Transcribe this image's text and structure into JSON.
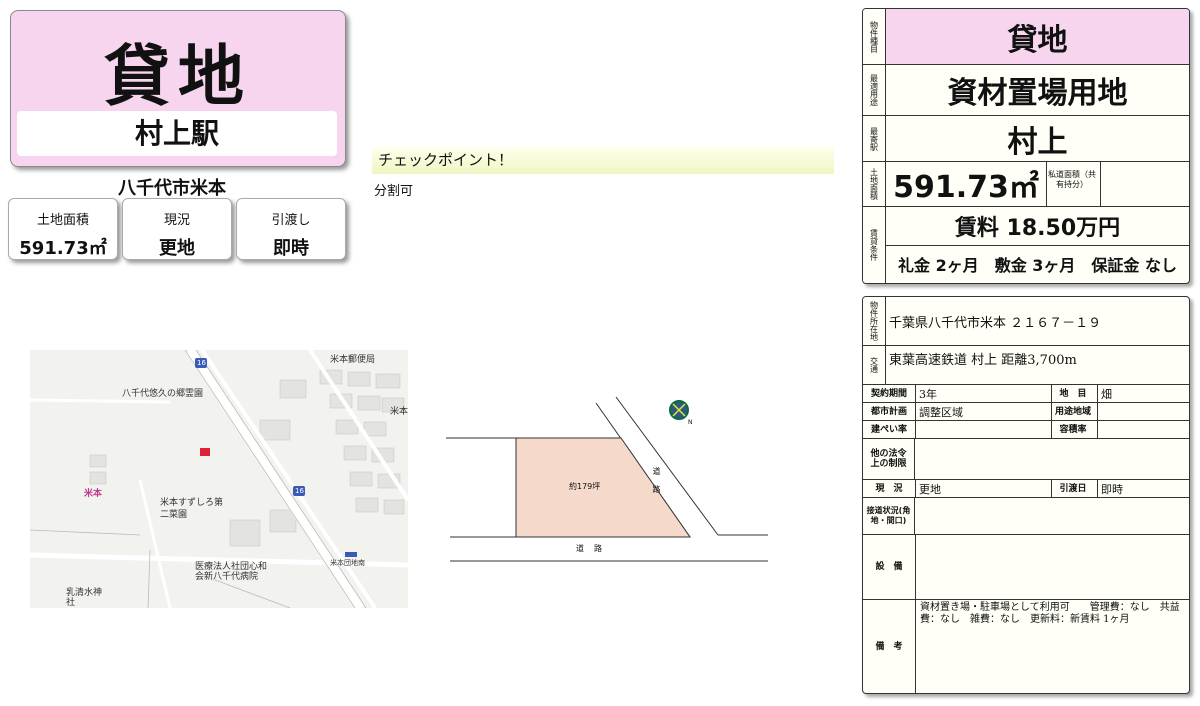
{
  "header": {
    "title": "貸地",
    "station": "村上駅",
    "address": "八千代市米本"
  },
  "cards": [
    {
      "label": "土地面積",
      "value": "591.73㎡"
    },
    {
      "label": "現況",
      "value": "更地"
    },
    {
      "label": "引渡し",
      "value": "即時"
    }
  ],
  "checkpoint": {
    "heading": "チェックポイント！",
    "text": "分割可"
  },
  "map": {
    "labels": [
      "米本郵便局",
      "八千代悠久の郷霊園",
      "米本",
      "米本すずしろ第二菜園",
      "医療法人社団心和会新八千代病院",
      "乳清水神社",
      "米本団地南",
      "米本",
      "16",
      "16"
    ]
  },
  "plot": {
    "area_label": "約179坪",
    "road_label_1": "道路",
    "road_label_2": "道路",
    "north_label": "N",
    "colors": {
      "lot": "#f5d9cb"
    }
  },
  "summary": {
    "type_head": "物件種目",
    "type": "貸地",
    "use_head": "最適用途",
    "use": "資材置場用地",
    "station_head": "最寄駅",
    "station": "村上",
    "area_head": "土地面積",
    "area": "591.73㎡",
    "private_road_head": "私道面積（共有持分）",
    "conditions_head": "賃貸条件",
    "rent": "賃料 18.50万円",
    "deposits": "礼金 2ヶ月　敷金 3ヶ月　保証金 なし"
  },
  "details": {
    "location_head": "物件所在地",
    "location": "千葉県八千代市米本 ２１６７－１９",
    "transport_head": "交通",
    "transport": "東葉高速鉄道 村上 距離3,700m",
    "contract_head": "契約期間",
    "contract": "3年",
    "land_cat_head": "地　目",
    "land_cat": "畑",
    "city_plan_head": "都市計画",
    "city_plan": "調整区域",
    "zoning_head": "用途地域",
    "zoning": "",
    "bcr_head": "建ぺい率",
    "bcr": "",
    "far_head": "容積率",
    "far": "",
    "other_law_head": "他の法令上の制限",
    "status_head": "現　況",
    "status": "更地",
    "handover_head": "引渡日",
    "handover": "即時",
    "road_head": "接道状況(角地・間口)",
    "equipment_head": "設　備",
    "remarks_head": "備　考",
    "remarks": "資材置き場・駐車場として利用可　　管理費：なし　共益費：なし　雑費：なし　更新料：新賃料 1ヶ月"
  }
}
